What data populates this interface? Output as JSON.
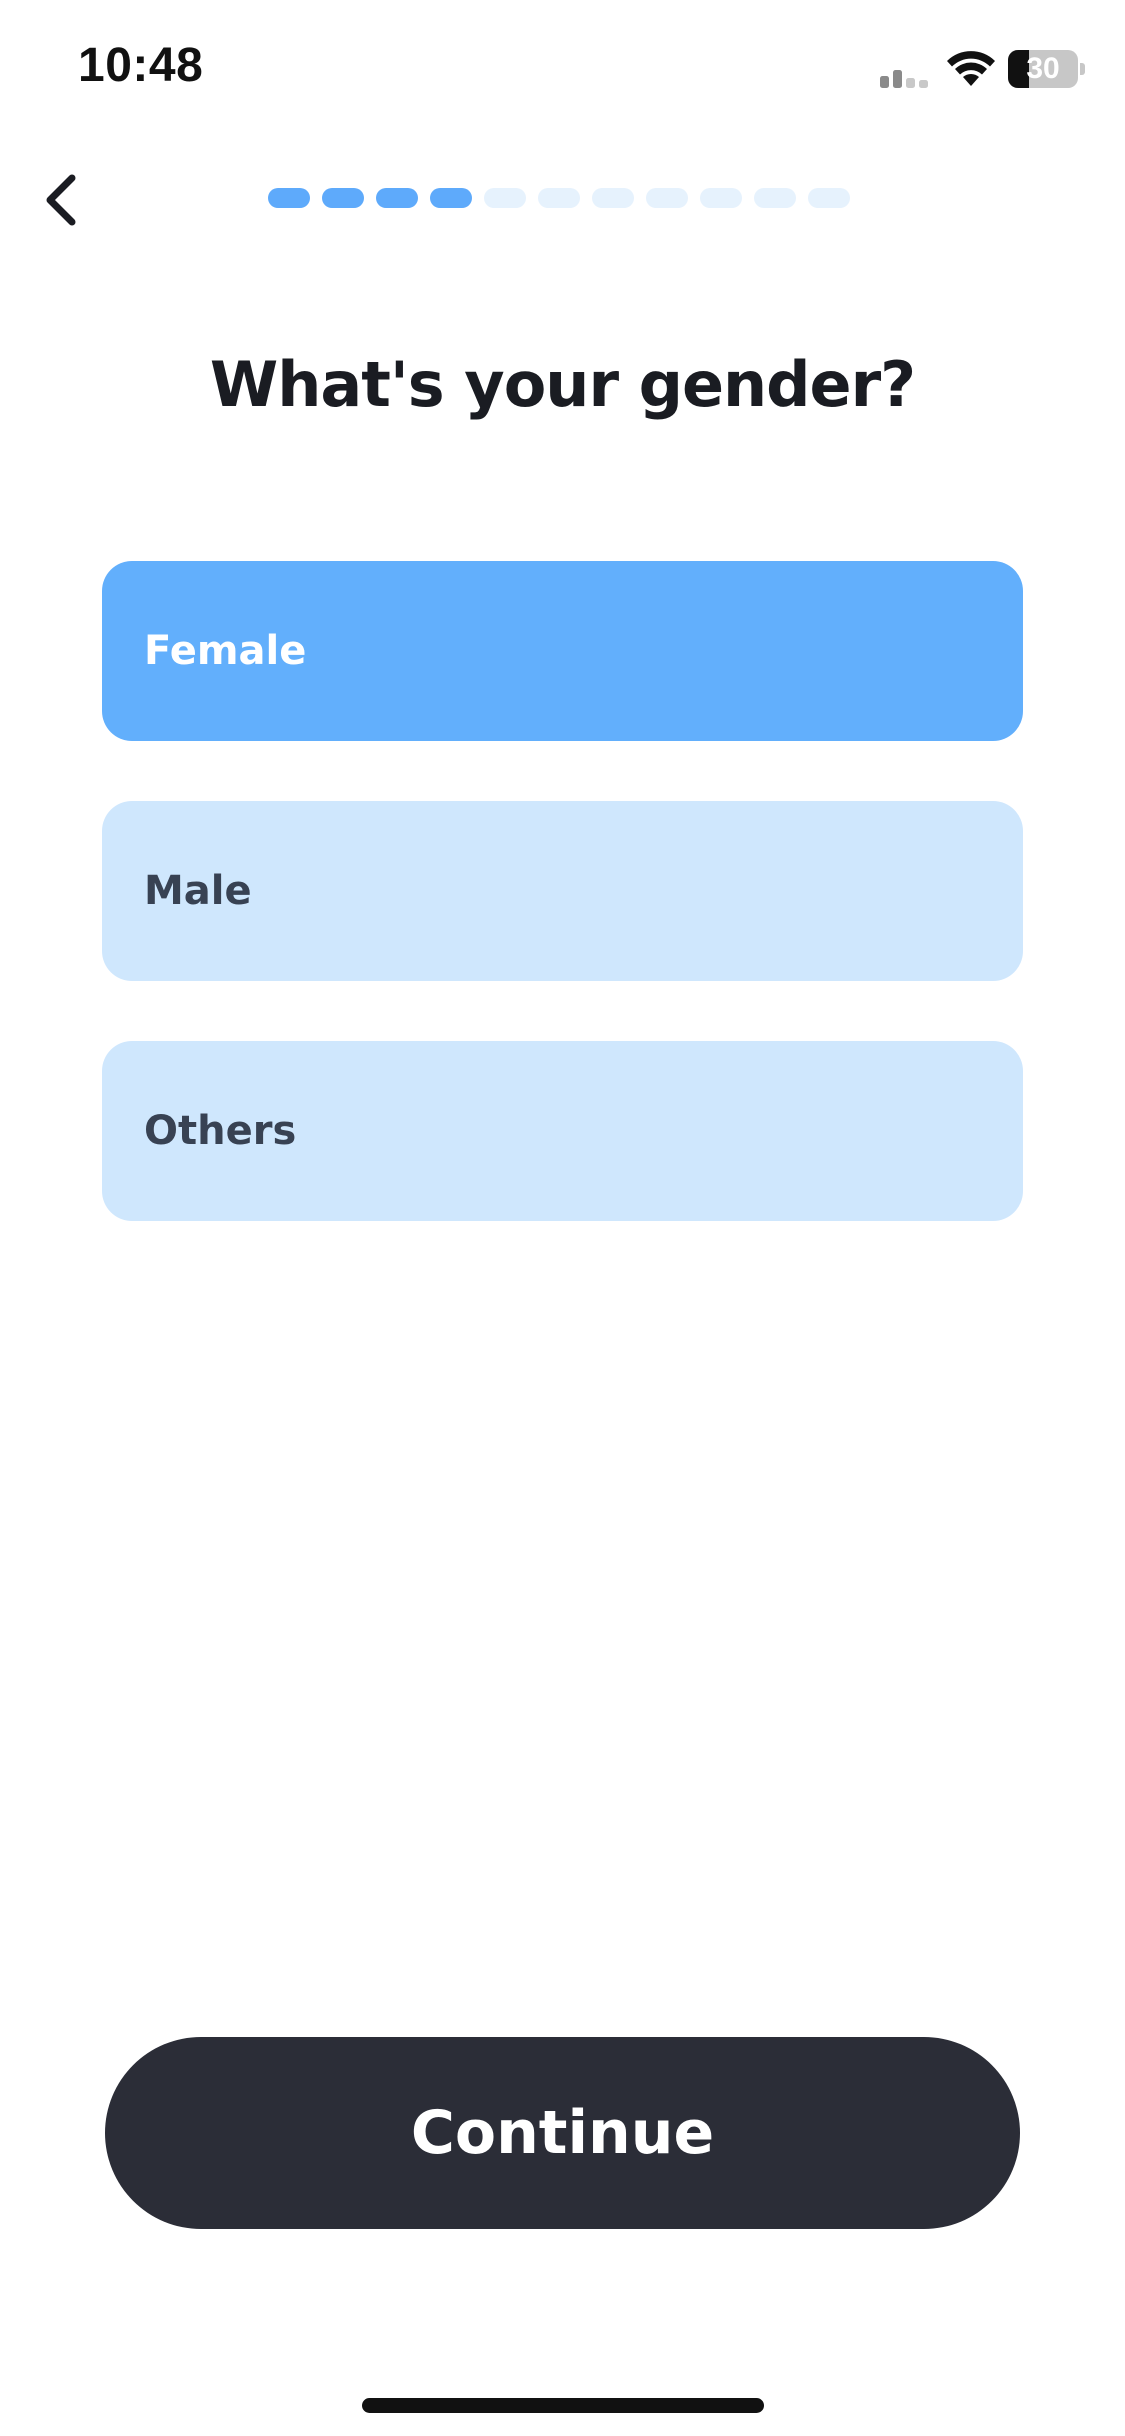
{
  "status_bar": {
    "time": "10:48",
    "battery_level": "30",
    "battery_fraction": 0.3,
    "icons": [
      "cellular-signal-icon",
      "wifi-icon",
      "battery-icon"
    ]
  },
  "header": {
    "back_icon": "chevron-left-icon",
    "progress": {
      "total_steps": 11,
      "completed_steps": 4,
      "active_color": "#5eaafb",
      "inactive_color": "#e6f2fd"
    }
  },
  "question": {
    "title": "What's your gender?"
  },
  "options": [
    {
      "label": "Female",
      "selected": true
    },
    {
      "label": "Male",
      "selected": false
    },
    {
      "label": "Others",
      "selected": false
    }
  ],
  "colors": {
    "selected_option": "#62affc",
    "unselected_option": "#cfe7fd",
    "primary_button": "#2b2d37"
  },
  "footer": {
    "continue_label": "Continue"
  }
}
